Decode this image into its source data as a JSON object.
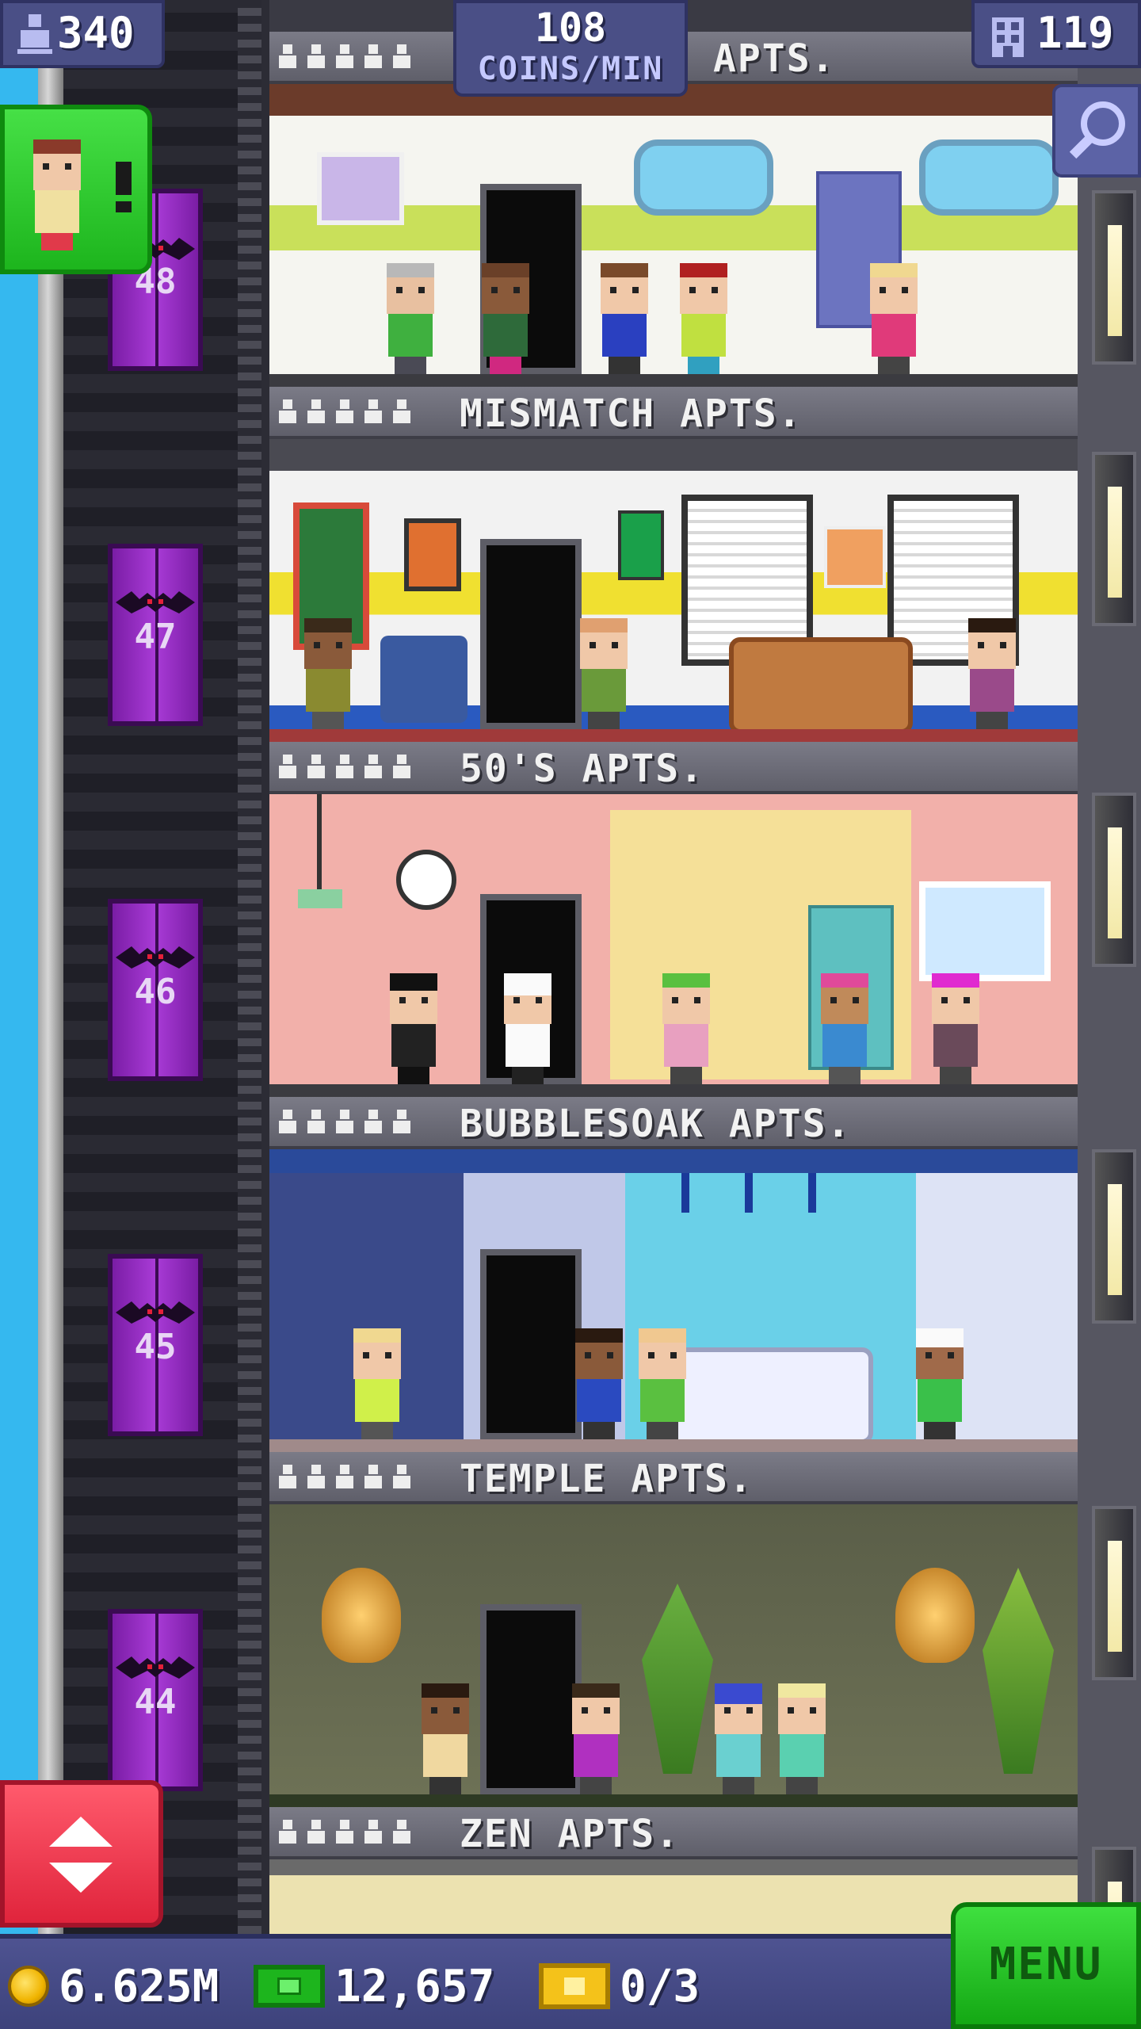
{
  "hud": {
    "population": "340",
    "coins_per_min_value": "108",
    "coins_per_min_label": "COINS/MIN",
    "floor_count": "119"
  },
  "shaft": {
    "floor_numbers": [
      "48",
      "47",
      "46",
      "45",
      "44"
    ]
  },
  "floors": [
    {
      "name": "APTS.",
      "stars": 5
    },
    {
      "name": "MISMATCH APTS.",
      "stars": 5
    },
    {
      "name": "50'S APTS.",
      "stars": 5
    },
    {
      "name": "BUBBLESOAK APTS.",
      "stars": 5
    },
    {
      "name": "TEMPLE APTS.",
      "stars": 5
    },
    {
      "name": "ZEN APTS.",
      "stars": 5
    }
  ],
  "bottom_bar": {
    "coins": "6.625M",
    "tower_bux": "12,657",
    "tickets": "0/3",
    "menu_label": "MENU"
  },
  "icons": {
    "population": "person-icon",
    "floors": "building-icon",
    "search": "magnifier-icon",
    "elevator": "up-down-arrows-icon",
    "coin": "coin-icon",
    "bux": "bux-icon",
    "ticket": "ticket-icon"
  },
  "colors": {
    "hud_bg": "#4a4f86",
    "menu_green": "#1db51d",
    "elevator_red": "#e0243c",
    "shaft_purple": "#a93bd7",
    "sky": "#35b8ef"
  }
}
